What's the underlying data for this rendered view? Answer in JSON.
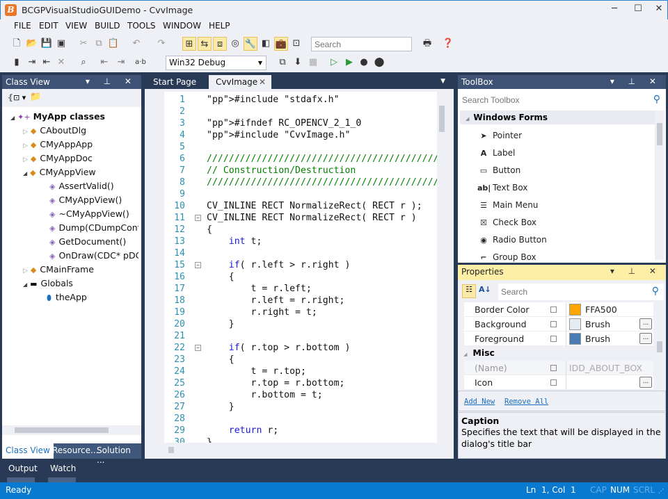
{
  "window": {
    "title": "BCGPVisualStudioGUIDemo - CvvImage",
    "logo": "B",
    "minimize": "─",
    "maximize": "☐",
    "close": "✕"
  },
  "menu": [
    "FILE",
    "EDIT",
    "VIEW",
    "BUILD",
    "TOOLS",
    "WINDOW",
    "HELP"
  ],
  "toolbar": {
    "search_placeholder": "Search",
    "config": "Win32 Debug"
  },
  "class_view": {
    "title": "Class View",
    "root": "MyApp classes",
    "items": [
      {
        "label": "CAboutDlg",
        "kind": "class"
      },
      {
        "label": "CMyAppApp",
        "kind": "class"
      },
      {
        "label": "CMyAppDoc",
        "kind": "class"
      },
      {
        "label": "CMyAppView",
        "kind": "class"
      },
      {
        "label": "AssertValid()",
        "kind": "method"
      },
      {
        "label": "CMyAppView()",
        "kind": "method"
      },
      {
        "label": "~CMyAppView()",
        "kind": "method"
      },
      {
        "label": "Dump(CDumpConte",
        "kind": "method"
      },
      {
        "label": "GetDocument()",
        "kind": "method"
      },
      {
        "label": "OnDraw(CDC* pDC)",
        "kind": "method"
      },
      {
        "label": "CMainFrame",
        "kind": "class"
      },
      {
        "label": "Globals",
        "kind": "folder"
      },
      {
        "label": "theApp",
        "kind": "variable"
      }
    ],
    "tabs": [
      "Class View",
      "Resource...",
      "Solution ..."
    ]
  },
  "editor": {
    "tabs": [
      "Start Page",
      "CvvImage"
    ],
    "active_tab": "CvvImage",
    "lines": [
      "#include \"stdafx.h\"",
      "",
      "#ifndef RC_OPENCV_2_1_0",
      "#include \"CvvImage.h\"",
      "",
      "//////////////////////////////////////////////////",
      "// Construction/Destruction",
      "//////////////////////////////////////////////////",
      "",
      "CV_INLINE RECT NormalizeRect( RECT r );",
      "CV_INLINE RECT NormalizeRect( RECT r )",
      "{",
      "    int t;",
      "",
      "    if( r.left > r.right )",
      "    {",
      "        t = r.left;",
      "        r.left = r.right;",
      "        r.right = t;",
      "    }",
      "",
      "    if( r.top > r.bottom )",
      "    {",
      "        t = r.top;",
      "        r.top = r.bottom;",
      "        r.bottom = t;",
      "    }",
      "",
      "    return r;",
      "}"
    ]
  },
  "toolbox": {
    "title": "ToolBox",
    "search_placeholder": "Search Toolbox",
    "group": "Windows Forms",
    "items": [
      {
        "label": "Pointer",
        "icon": "➤"
      },
      {
        "label": "Label",
        "icon": "A"
      },
      {
        "label": "Button",
        "icon": "▭"
      },
      {
        "label": "Text Box",
        "icon": "ab|"
      },
      {
        "label": "Main Menu",
        "icon": "☰"
      },
      {
        "label": "Check Box",
        "icon": "☒"
      },
      {
        "label": "Radio Button",
        "icon": "◉"
      },
      {
        "label": "Group Box",
        "icon": "⌐"
      }
    ]
  },
  "properties": {
    "title": "Properties",
    "search_placeholder": "Search",
    "rows": [
      {
        "name": "Border Color",
        "value": "FFA500",
        "swatch": "#FFA500"
      },
      {
        "name": "Background",
        "value": "Brush",
        "swatch": "#e6ecf4",
        "button": "..."
      },
      {
        "name": "Foreground",
        "value": "Brush",
        "swatch": "#4a7bb5",
        "button": "..."
      }
    ],
    "category": "Misc",
    "misc_rows": [
      {
        "name": "(Name)",
        "value": "IDD_ABOUT_BOX (..."
      },
      {
        "name": "Icon",
        "value": "",
        "button": "..."
      }
    ],
    "links": [
      "Add New",
      "Remove All"
    ],
    "desc_title": "Caption",
    "desc_text": "Specifies the text that will be displayed in the dialog's title bar"
  },
  "bottom_tabs": [
    "Output",
    "Watch"
  ],
  "status": {
    "text": "Ready",
    "ln": "Ln",
    "ln_val": "1, Col",
    "col_val": "1",
    "cap": "CAP",
    "num": "NUM",
    "scrl": "SCRL"
  }
}
